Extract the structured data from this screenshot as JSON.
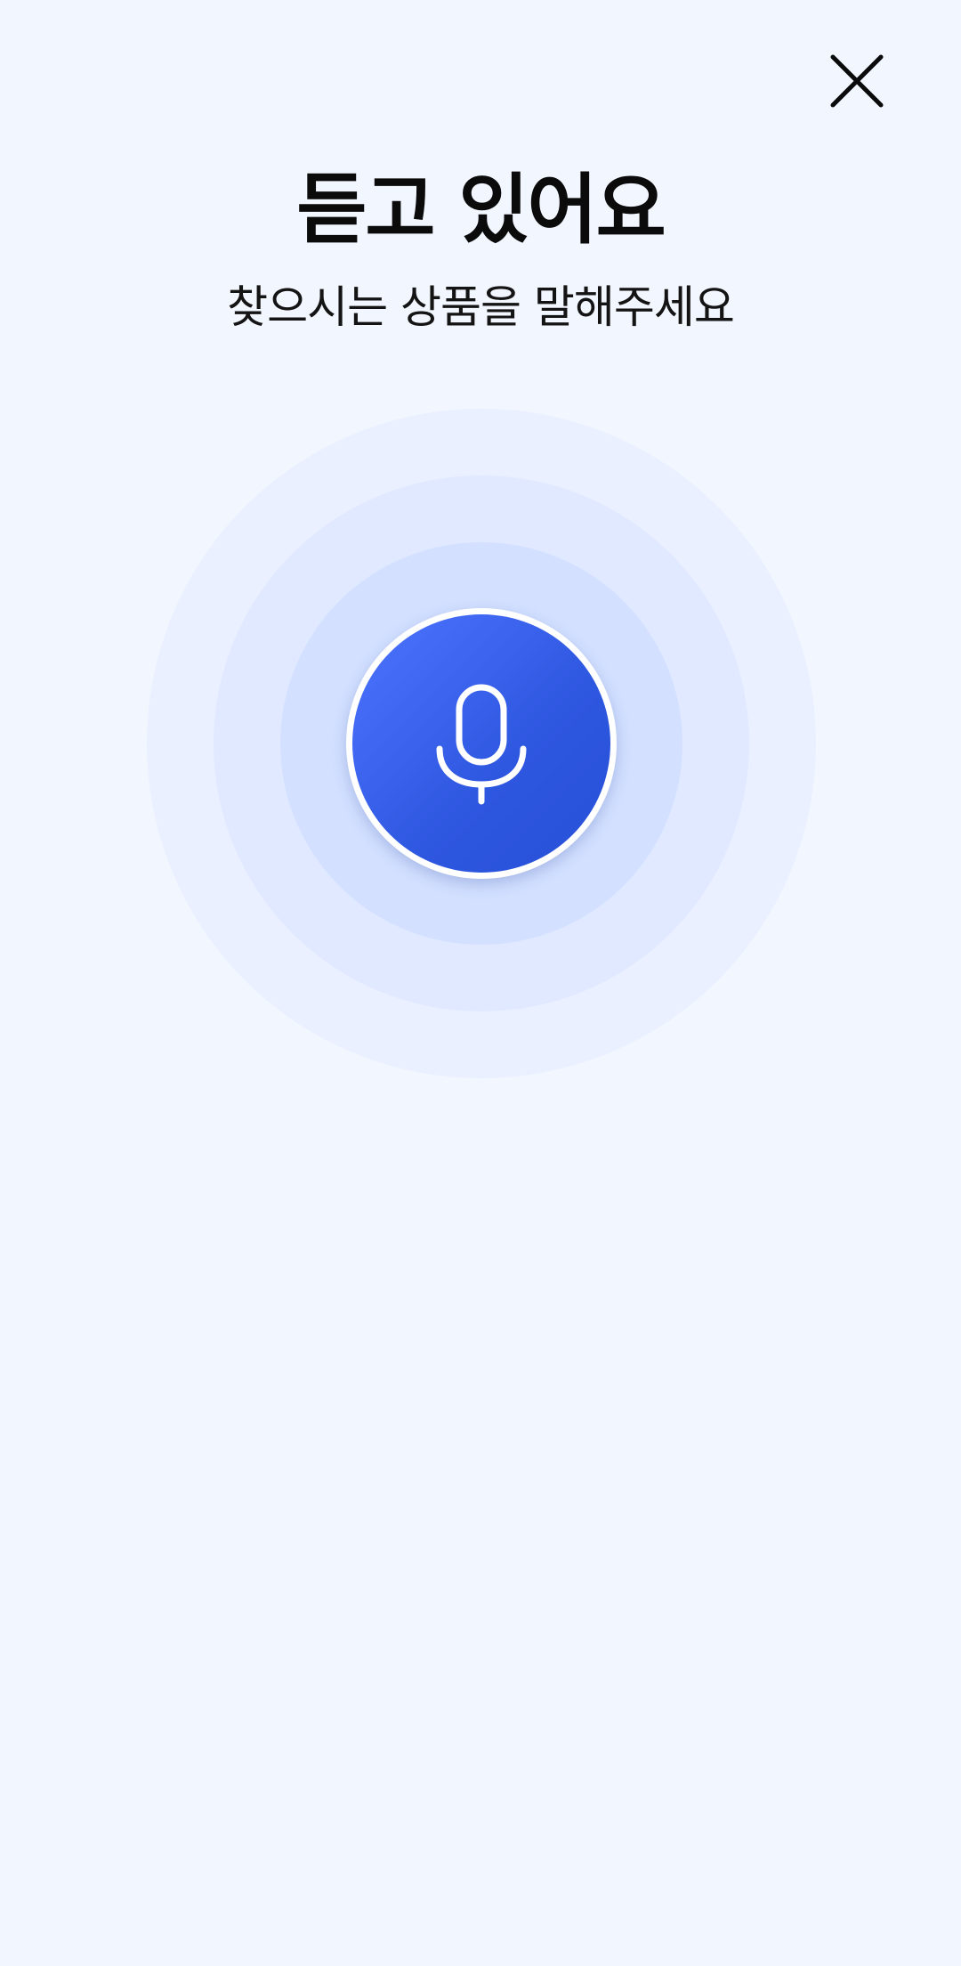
{
  "header": {
    "close_icon": "close-icon"
  },
  "voice_search": {
    "title": "듣고 있어요",
    "subtitle": "찾으시는 상품을 말해주세요",
    "mic_icon": "microphone-icon"
  },
  "colors": {
    "background": "#F2F6FF",
    "accent": "#3A63F0",
    "ring_outer": "#EAF0FF",
    "ring_middle": "#E0E9FF",
    "ring_inner": "#D3E0FF"
  }
}
